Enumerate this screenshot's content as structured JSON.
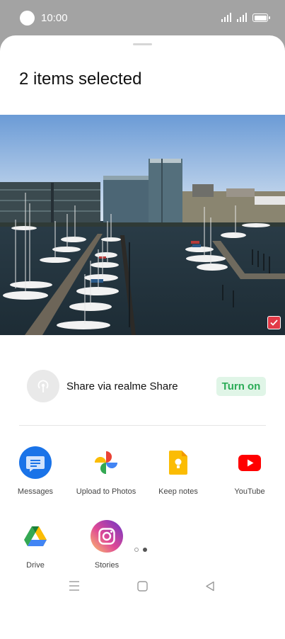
{
  "status_bar": {
    "time": "10:00",
    "icons": [
      "signal-icon",
      "signal-icon",
      "battery-icon"
    ]
  },
  "sheet": {
    "title": "2 items selected"
  },
  "preview": {
    "selected": true,
    "check_color": "#e23a47"
  },
  "realme_share": {
    "label": "Share via realme Share",
    "button": "Turn on",
    "accent": "#2bac57"
  },
  "apps": [
    {
      "label": "Messages",
      "icon": "messages-icon"
    },
    {
      "label": "Upload to Photos",
      "icon": "google-photos-icon"
    },
    {
      "label": "Keep notes",
      "icon": "keep-notes-icon"
    },
    {
      "label": "YouTube",
      "icon": "youtube-icon"
    },
    {
      "label": "Drive",
      "icon": "google-drive-icon"
    },
    {
      "label": "Stories",
      "icon": "instagram-icon"
    }
  ],
  "pager": {
    "pages": 2,
    "current": 2
  },
  "nav_bar": {
    "icons": [
      "menu-icon",
      "home-icon",
      "back-icon"
    ]
  }
}
